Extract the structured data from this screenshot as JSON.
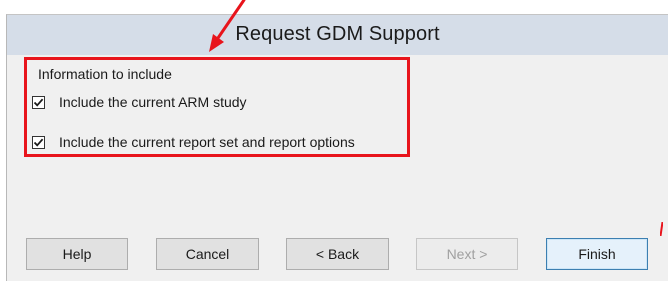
{
  "dialog": {
    "title": "Request GDM Support"
  },
  "group": {
    "label": "Information to include",
    "items": [
      {
        "label": "Include the current ARM study",
        "checked": true
      },
      {
        "label": "Include the current report set and report options",
        "checked": true
      }
    ]
  },
  "buttons": {
    "help": "Help",
    "cancel": "Cancel",
    "back": "< Back",
    "next": "Next >",
    "finish": "Finish"
  },
  "annotation": {
    "color": "#e8141c"
  }
}
